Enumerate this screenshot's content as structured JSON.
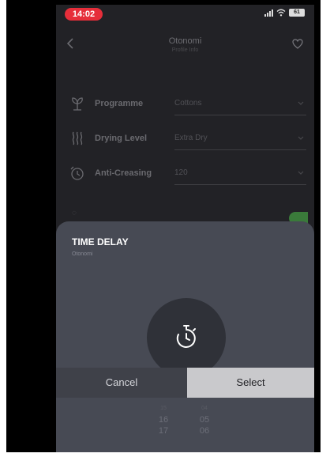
{
  "status_bar": {
    "time": "14:02",
    "battery": "61"
  },
  "header": {
    "title": "Otonomi",
    "subtitle": "Profile Info"
  },
  "settings": [
    {
      "id": "programme",
      "label": "Programme",
      "value": "Cottons",
      "icon": "plant-icon"
    },
    {
      "id": "drying-level",
      "label": "Drying Level",
      "value": "Extra Dry",
      "icon": "heat-waves-icon"
    },
    {
      "id": "anti-creasing",
      "label": "Anti-Creasing",
      "value": "120",
      "icon": "timer-rotate-icon"
    }
  ],
  "modal": {
    "title": "TIME DELAY",
    "subtitle": "Otonomi",
    "cancel_label": "Cancel",
    "select_label": "Select",
    "hours": [
      "15",
      "16",
      "17"
    ],
    "minutes": [
      "04",
      "05",
      "06"
    ]
  },
  "colors": {
    "accent_red": "#e62e3a",
    "toggle_green": "#3a7a3a",
    "sheet": "#474a54",
    "select_button": "#c9c9cc"
  }
}
